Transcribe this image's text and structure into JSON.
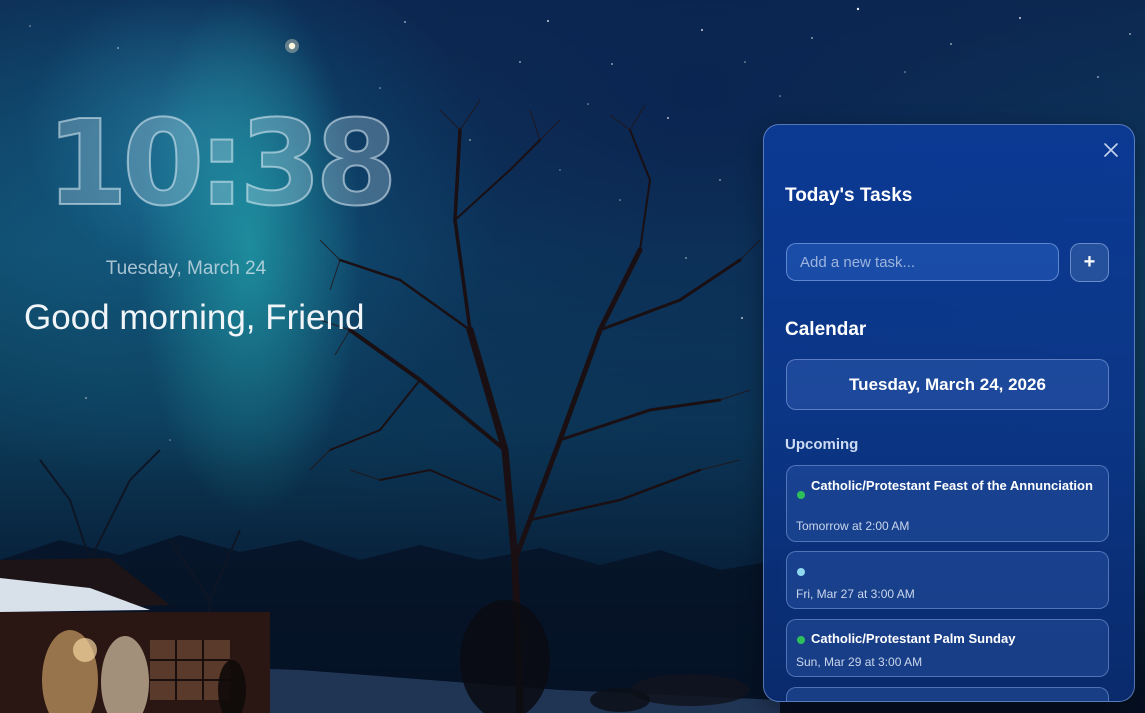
{
  "clock": {
    "time": "10:38",
    "date": "Tuesday, March 24"
  },
  "greeting": "Good morning, Friend",
  "panel": {
    "close_icon": "close-icon",
    "tasks_heading": "Today's Tasks",
    "task_input_placeholder": "Add a new task...",
    "add_button_label": "+",
    "calendar_heading": "Calendar",
    "calendar_date": "Tuesday, March 24, 2026",
    "upcoming_heading": "Upcoming",
    "events": [
      {
        "title": "Catholic/Protestant Feast of the Annunciation",
        "when": "Tomorrow at 2:00 AM",
        "dot_color": "#2fbf5a"
      },
      {
        "title": "",
        "when": "Fri, Mar 27 at 3:00 AM",
        "dot_color": "#8fd8f0"
      },
      {
        "title": "Catholic/Protestant Palm Sunday",
        "when": "Sun, Mar 29 at 3:00 AM",
        "dot_color": "#2fbf5a"
      }
    ]
  },
  "colors": {
    "panel_bg": "#0c3a96",
    "accent_green": "#2fbf5a",
    "accent_cyan": "#8fd8f0"
  }
}
